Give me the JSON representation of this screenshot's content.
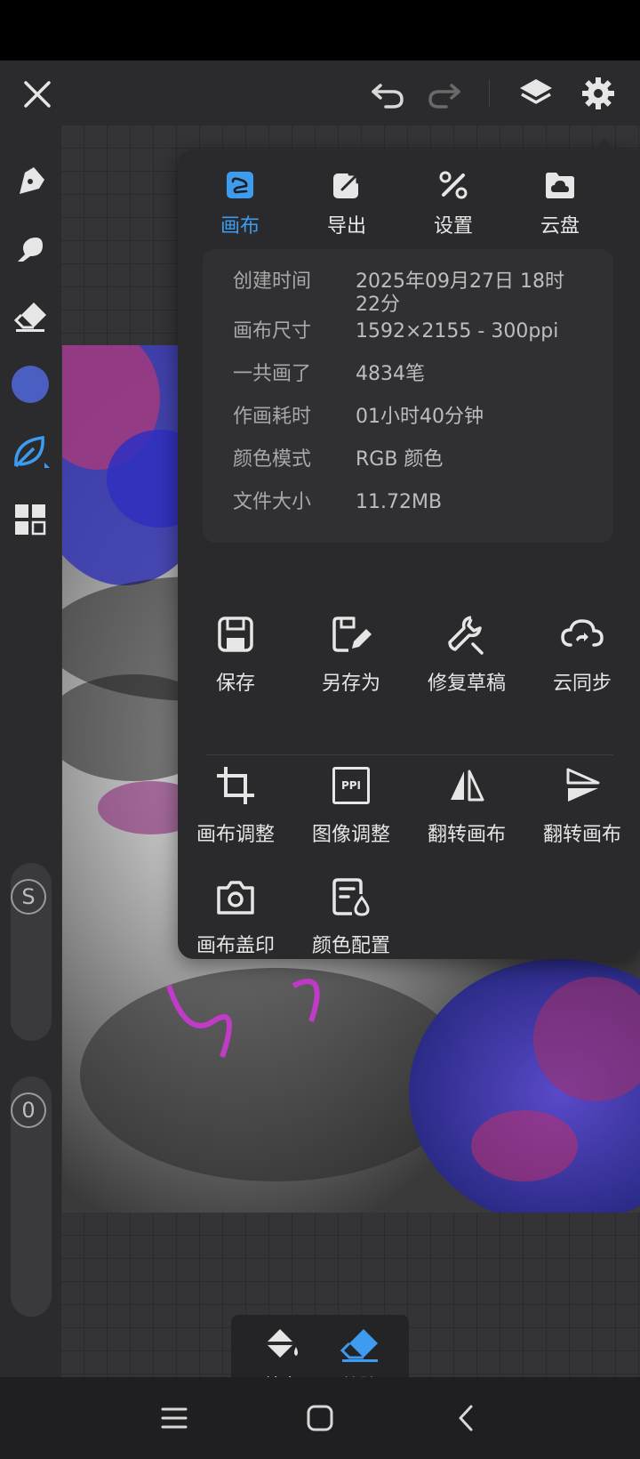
{
  "top_bar": {
    "close_icon": "close-icon",
    "undo_icon": "undo-icon",
    "redo_icon": "redo-icon",
    "layers_icon": "layers-icon",
    "settings_icon": "gear-icon"
  },
  "left_toolbar": {
    "tools": [
      "brush-tool-icon",
      "smudge-tool-icon",
      "eraser-tool-icon",
      "color-swatch",
      "leaf-brush-icon",
      "grid-tools-icon"
    ],
    "color_swatch": "#4a5fc1",
    "size_slider_label": "S",
    "opacity_slider_label": "0"
  },
  "panel": {
    "tabs": [
      {
        "label": "画布",
        "icon": "canvas-icon",
        "active": true
      },
      {
        "label": "导出",
        "icon": "export-icon",
        "active": false
      },
      {
        "label": "设置",
        "icon": "tools-icon",
        "active": false
      },
      {
        "label": "云盘",
        "icon": "cloud-drive-icon",
        "active": false
      }
    ],
    "info": [
      {
        "key": "创建时间",
        "value": "2025年09月27日 18时",
        "value_line2": "22分"
      },
      {
        "key": "画布尺寸",
        "value": "1592×2155 - 300ppi"
      },
      {
        "key": "一共画了",
        "value": "4834笔"
      },
      {
        "key": "作画耗时",
        "value": "01小时40分钟"
      },
      {
        "key": "颜色模式",
        "value": "RGB 颜色"
      },
      {
        "key": "文件大小",
        "value": "11.72MB"
      }
    ],
    "actions_row1": [
      {
        "label": "保存",
        "icon": "save-icon"
      },
      {
        "label": "另存为",
        "icon": "save-as-icon"
      },
      {
        "label": "修复草稿",
        "icon": "wrench-icon"
      },
      {
        "label": "云同步",
        "icon": "cloud-sync-icon"
      }
    ],
    "actions_row2": [
      {
        "label": "画布调整",
        "icon": "crop-icon"
      },
      {
        "label": "图像调整",
        "icon": "ppi-icon",
        "icon_text": "PPI"
      },
      {
        "label": "翻转画布",
        "icon": "flip-horizontal-icon"
      },
      {
        "label": "翻转画布",
        "icon": "flip-vertical-icon"
      }
    ],
    "actions_row3": [
      {
        "label": "画布盖印",
        "icon": "camera-icon"
      },
      {
        "label": "颜色配置",
        "icon": "color-profile-icon"
      }
    ]
  },
  "bottom_tools": [
    {
      "label": "填充",
      "icon": "fill-bucket-icon",
      "active": false
    },
    {
      "label": "擦除",
      "icon": "eraser-icon",
      "active": true
    }
  ],
  "colors": {
    "accent": "#3d9cf0",
    "panel_bg": "#2a2a2d",
    "app_bg": "#2b2b2e"
  },
  "nav_bar": [
    "menu-icon",
    "home-icon",
    "back-icon"
  ]
}
